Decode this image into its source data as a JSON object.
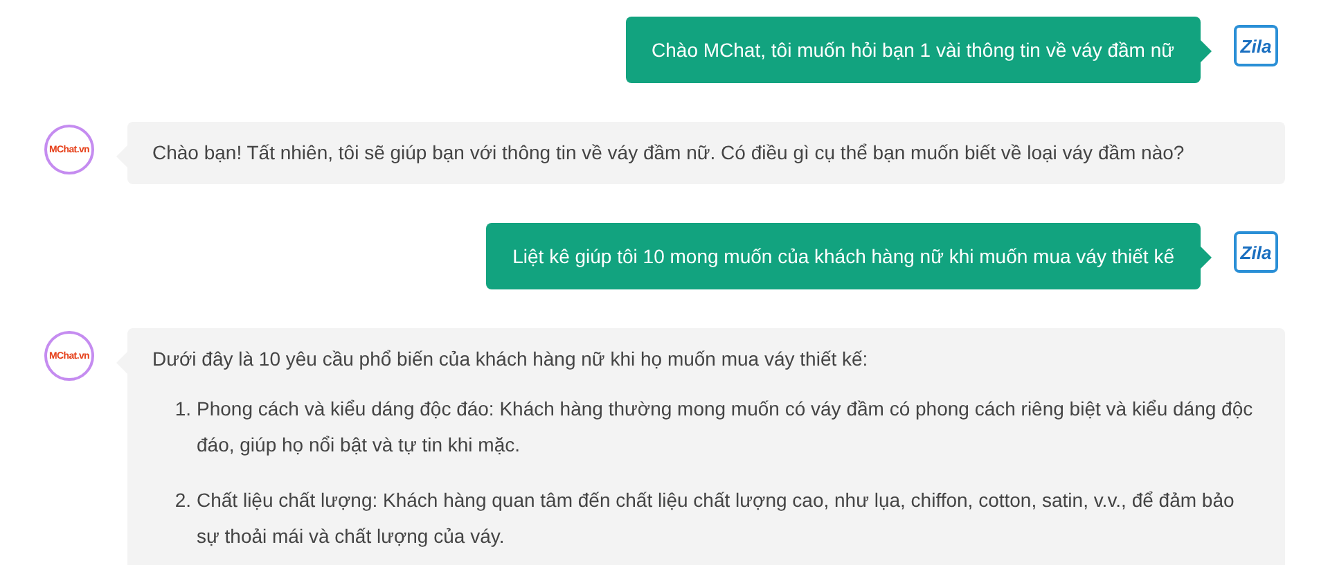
{
  "messages": [
    {
      "kind": "user",
      "avatar_label": "Zila",
      "text": "Chào MChat, tôi muốn hỏi bạn 1 vài thông tin về váy đầm nữ"
    },
    {
      "kind": "bot",
      "avatar_label": "MChat.vn",
      "text": "Chào bạn! Tất nhiên, tôi sẽ giúp bạn với thông tin về váy đầm nữ. Có điều gì cụ thể bạn muốn biết về loại váy đầm nào?"
    },
    {
      "kind": "user",
      "avatar_label": "Zila",
      "text": "Liệt kê giúp tôi 10 mong muốn của khách hàng nữ khi muốn mua váy thiết kế"
    },
    {
      "kind": "bot",
      "avatar_label": "MChat.vn",
      "text": "Dưới đây là 10 yêu cầu phổ biến của khách hàng nữ khi họ muốn mua váy thiết kế:",
      "list": [
        {
          "number": "1.",
          "text": "Phong cách và kiểu dáng độc đáo: Khách hàng thường mong muốn có váy đầm có phong cách riêng biệt và kiểu dáng độc đáo, giúp họ nổi bật và tự tin khi mặc."
        },
        {
          "number": "2.",
          "text": "Chất liệu chất lượng: Khách hàng quan tâm đến chất liệu chất lượng cao, như lụa, chiffon, cotton, satin, v.v., để đảm bảo sự thoải mái và chất lượng của váy."
        }
      ]
    }
  ]
}
